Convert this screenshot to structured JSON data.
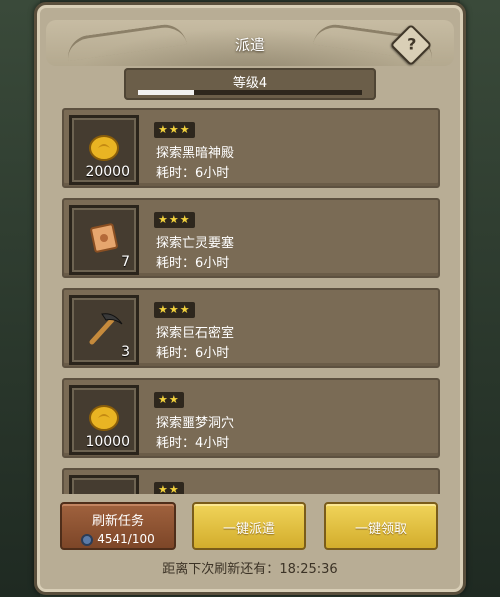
{
  "dialog": {
    "title": "派遣",
    "help_icon": "question-mark-icon"
  },
  "level": {
    "label": "等级4",
    "progress": 0.25
  },
  "missions": [
    {
      "stars": "★★★",
      "star_count": 3,
      "name": "探索黑暗神殿",
      "time": "耗时：6小时",
      "reward_icon": "gold-coin-icon",
      "quantity": "20000"
    },
    {
      "stars": "★★★",
      "star_count": 3,
      "name": "探索亡灵要塞",
      "time": "耗时：6小时",
      "reward_icon": "scroll-icon",
      "quantity": "7"
    },
    {
      "stars": "★★★",
      "star_count": 3,
      "name": "探索巨石密室",
      "time": "耗时：6小时",
      "reward_icon": "pickaxe-icon",
      "quantity": "3"
    },
    {
      "stars": "★★",
      "star_count": 2,
      "name": "探索噩梦洞穴",
      "time": "耗时：4小时",
      "reward_icon": "gold-coin-icon",
      "quantity": "10000"
    },
    {
      "stars": "★★",
      "star_count": 2
    }
  ],
  "actions": {
    "refresh_label": "刷新任务",
    "refresh_cost": "4541/100",
    "dispatch_all_label": "一键派遣",
    "collect_all_label": "一键领取"
  },
  "footer": {
    "timer_label": "距离下次刷新还有：",
    "timer_value": "18:25:36"
  },
  "colors": {
    "panel": "#b8ad95",
    "card": "#7a6b55",
    "gold_button": "#e6c445",
    "refresh_button": "#8f5434",
    "star": "#f3d23c"
  }
}
